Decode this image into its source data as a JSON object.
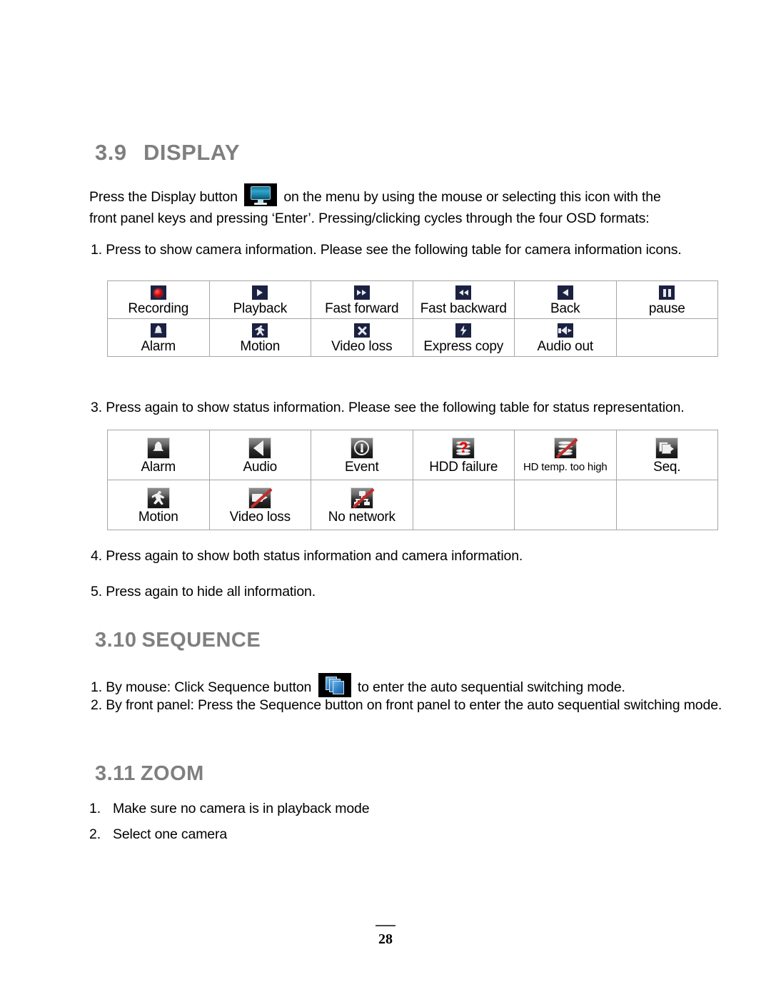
{
  "document": {
    "page_number": "28"
  },
  "sections": {
    "display": {
      "number": "3.9",
      "title": "DISPLAY",
      "intro_before_icon": "Press the Display button",
      "icon_name": "display-button-icon",
      "intro_after_icon": "on the menu by using the mouse or selecting this icon with the front panel keys and pressing ‘Enter’.  Pressing/clicking cycles through the four OSD formats:",
      "step_1": "1. Press to show camera information. Please see the following table for camera information icons.",
      "step_3": "3. Press again to show status information. Please see the following table for status representation.",
      "step_4": "4. Press again to show both status information and camera information.",
      "step_5": "5. Press again to hide all information."
    },
    "sequence": {
      "number": "3.10",
      "title": "SEQUENCE",
      "item_1_before_icon": "1. By mouse: Click Sequence button",
      "icon_name": "sequence-button-icon",
      "item_1_after_icon": "to enter the auto sequential switching mode.",
      "item_2": "2. By front panel: Press the Sequence button on front panel to enter the auto sequential switching mode."
    },
    "zoom": {
      "number": "3.11",
      "title": "ZOOM",
      "items": [
        {
          "num": "1.",
          "text": "Make sure no camera is in playback mode"
        },
        {
          "num": "2.",
          "text": "Select one camera"
        }
      ]
    }
  },
  "camera_info_table": {
    "rows": [
      [
        {
          "label": "Recording",
          "icon": "record-dot-icon"
        },
        {
          "label": "Playback",
          "icon": "play-icon"
        },
        {
          "label": "Fast forward",
          "icon": "fast-forward-icon"
        },
        {
          "label": "Fast backward",
          "icon": "fast-backward-icon"
        },
        {
          "label": "Back",
          "icon": "back-icon"
        },
        {
          "label": "pause",
          "icon": "pause-icon"
        }
      ],
      [
        {
          "label": "Alarm",
          "icon": "bell-icon"
        },
        {
          "label": "Motion",
          "icon": "running-person-icon"
        },
        {
          "label": "Video loss",
          "icon": "x-cross-icon"
        },
        {
          "label": "Express copy",
          "icon": "lightning-bolt-icon"
        },
        {
          "label": "Audio out",
          "icon": "speaker-icon"
        },
        {
          "label": "",
          "icon": ""
        }
      ]
    ]
  },
  "status_table": {
    "rows": [
      [
        {
          "label": "Alarm",
          "icon": "bell-status-icon",
          "small": false
        },
        {
          "label": "Audio",
          "icon": "speaker-status-icon",
          "small": false
        },
        {
          "label": "Event",
          "icon": "exclamation-circle-icon",
          "small": false
        },
        {
          "label": "HDD failure",
          "icon": "hdd-question-icon",
          "small": false
        },
        {
          "label": "HD temp. too high",
          "icon": "hdd-slashed-icon",
          "small": true
        },
        {
          "label": "Seq.",
          "icon": "sequence-status-icon",
          "small": false
        }
      ],
      [
        {
          "label": "Motion",
          "icon": "running-person-status-icon",
          "small": false
        },
        {
          "label": "Video loss",
          "icon": "camcorder-slashed-icon",
          "small": false
        },
        {
          "label": "No network",
          "icon": "network-slashed-icon",
          "small": false
        },
        {
          "label": "",
          "icon": "",
          "small": false
        },
        {
          "label": "",
          "icon": "",
          "small": false
        },
        {
          "label": "",
          "icon": "",
          "small": false
        }
      ]
    ]
  },
  "colors": {
    "heading": "#7f7f7f",
    "icon_navy": "#1b2140",
    "record_red": "#e00000",
    "slash_red": "#c42b2b",
    "table_border": "#a6a6a6",
    "text": "#000000"
  }
}
